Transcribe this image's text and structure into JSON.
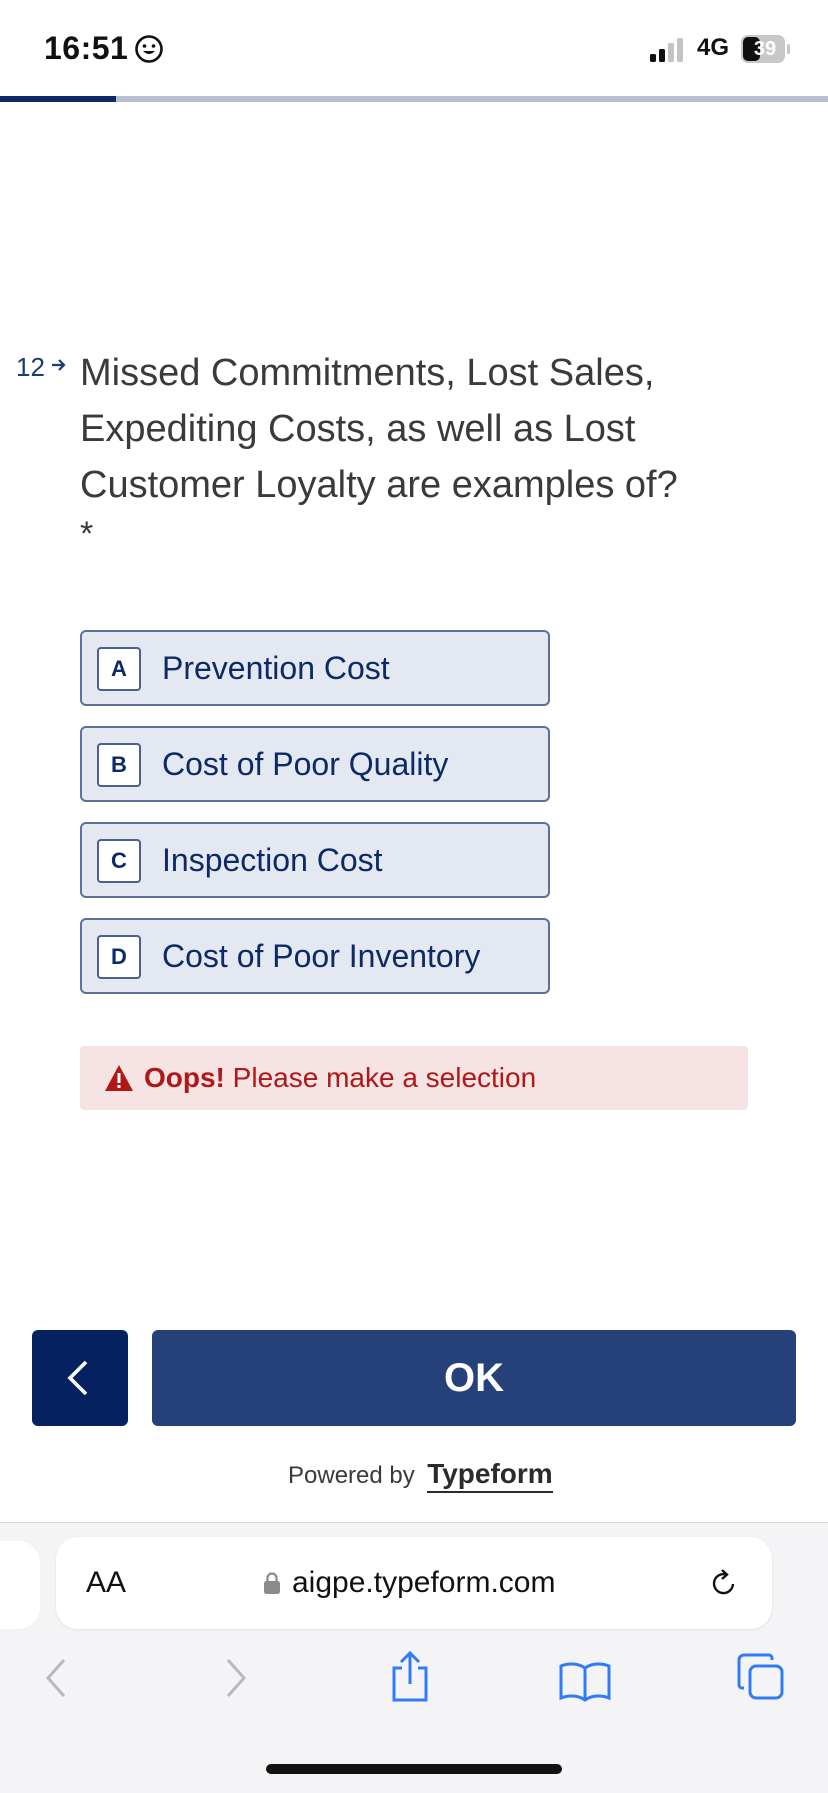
{
  "status_bar": {
    "time": "16:51",
    "network": "4G",
    "battery": "39"
  },
  "progress": {
    "fraction": 0.14
  },
  "question": {
    "number": "12",
    "text": "Missed Commitments, Lost Sales, Expediting Costs, as well as Lost Customer Loyalty are examples of?",
    "required_mark": "*"
  },
  "choices": [
    {
      "key": "A",
      "label": "Prevention Cost"
    },
    {
      "key": "B",
      "label": "Cost of Poor Quality"
    },
    {
      "key": "C",
      "label": "Inspection Cost"
    },
    {
      "key": "D",
      "label": "Cost of Poor Inventory"
    }
  ],
  "error": {
    "title": "Oops!",
    "message": "Please make a selection"
  },
  "buttons": {
    "ok_label": "OK"
  },
  "footer": {
    "powered_by": "Powered by",
    "brand": "Typeform"
  },
  "browser": {
    "aa_label": "AA",
    "url": "aigpe.typeform.com"
  },
  "colors": {
    "brand_dark": "#06215f",
    "ok_button": "#26417a",
    "error_text": "#b01818",
    "error_bg": "#f6e3e4"
  }
}
